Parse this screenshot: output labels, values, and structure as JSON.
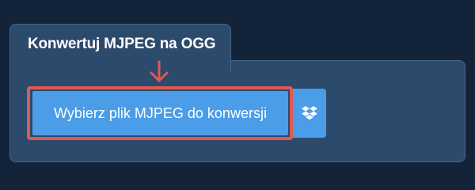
{
  "converter": {
    "title": "Konwertuj MJPEG na OGG",
    "upload_label": "Wybierz plik MJPEG do konwersji"
  },
  "icons": {
    "arrow": "arrow-down-icon",
    "dropbox": "dropbox-icon"
  },
  "colors": {
    "background": "#12233a",
    "panel": "#2c4a6b",
    "button": "#4b9de8",
    "highlight": "#e05a55"
  }
}
